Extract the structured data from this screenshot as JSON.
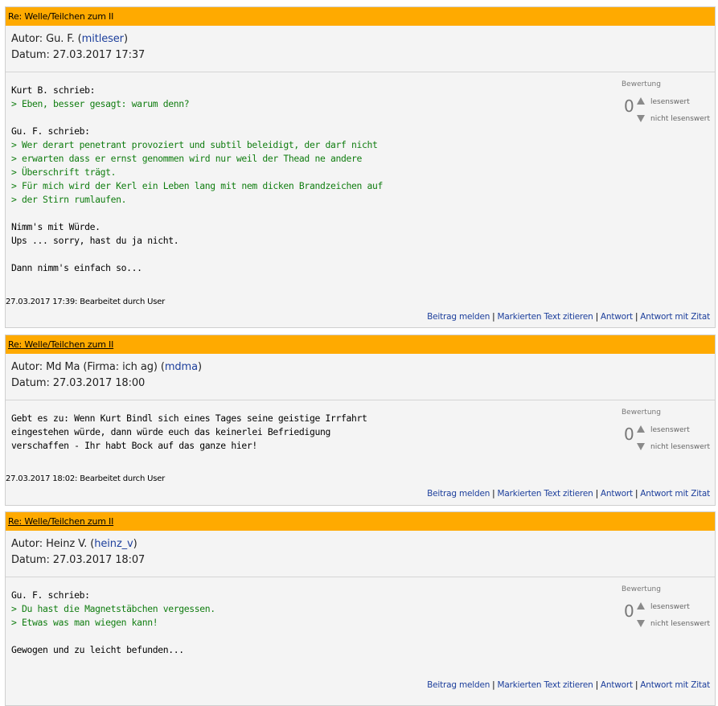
{
  "rating_label": "Bewertung",
  "rating_up_label": "lesenswert",
  "rating_down_label": "nicht lesenswert",
  "actions": {
    "report": "Beitrag melden",
    "quote_selected": "Markierten Text zitieren",
    "reply": "Antwort",
    "reply_quote": "Antwort mit Zitat",
    "separator": "|"
  },
  "posts": [
    {
      "title": "Re: Welle/Teilchen zum II",
      "author_label": "Autor: Gu. F. (",
      "author_id": "mitleser",
      "author_close": ")",
      "date": "Datum: 27.03.2017 17:37",
      "score": "0",
      "lines": [
        {
          "t": "Kurt B. schrieb:",
          "q": false
        },
        {
          "t": "> Eben, besser gesagt: warum denn?",
          "q": true
        },
        {
          "t": "",
          "q": false
        },
        {
          "t": "Gu. F. schrieb:",
          "q": false
        },
        {
          "t": "> Wer derart penetrant provoziert und subtil beleidigt, der darf nicht",
          "q": true
        },
        {
          "t": "> erwarten dass er ernst genommen wird nur weil der Thead ne andere",
          "q": true
        },
        {
          "t": "> Überschrift trägt.",
          "q": true
        },
        {
          "t": "> Für mich wird der Kerl ein Leben lang mit nem dicken Brandzeichen auf",
          "q": true
        },
        {
          "t": "> der Stirn rumlaufen.",
          "q": true
        },
        {
          "t": "",
          "q": false
        },
        {
          "t": "Nimm's mit Würde.",
          "q": false
        },
        {
          "t": "Ups ... sorry, hast du ja nicht.",
          "q": false
        },
        {
          "t": "",
          "q": false
        },
        {
          "t": "Dann nimm's einfach so...",
          "q": false
        }
      ],
      "edited": "27.03.2017 17:39: Bearbeitet durch User"
    },
    {
      "title": "Re: Welle/Teilchen zum II",
      "author_label": "Autor: Md Ma (Firma: ich ag) (",
      "author_id": "mdma",
      "author_close": ")",
      "date": "Datum: 27.03.2017 18:00",
      "score": "0",
      "lines": [
        {
          "t": "Gebt es zu: Wenn Kurt Bindl sich eines Tages seine geistige Irrfahrt",
          "q": false
        },
        {
          "t": "eingestehen würde, dann würde euch das keinerlei Befriedigung",
          "q": false
        },
        {
          "t": "verschaffen - Ihr habt Bock auf das ganze hier!",
          "q": false
        }
      ],
      "edited": "27.03.2017 18:02: Bearbeitet durch User"
    },
    {
      "title": "Re: Welle/Teilchen zum II",
      "author_label": "Autor: Heinz V. (",
      "author_id": "heinz_v",
      "author_close": ")",
      "date": "Datum: 27.03.2017 18:07",
      "score": "0",
      "lines": [
        {
          "t": "Gu. F. schrieb:",
          "q": false
        },
        {
          "t": "> Du hast die Magnetstäbchen vergessen.",
          "q": true
        },
        {
          "t": "> Etwas was man wiegen kann!",
          "q": true
        },
        {
          "t": "",
          "q": false
        },
        {
          "t": "Gewogen und zu leicht befunden...",
          "q": false
        }
      ],
      "edited": ""
    }
  ]
}
